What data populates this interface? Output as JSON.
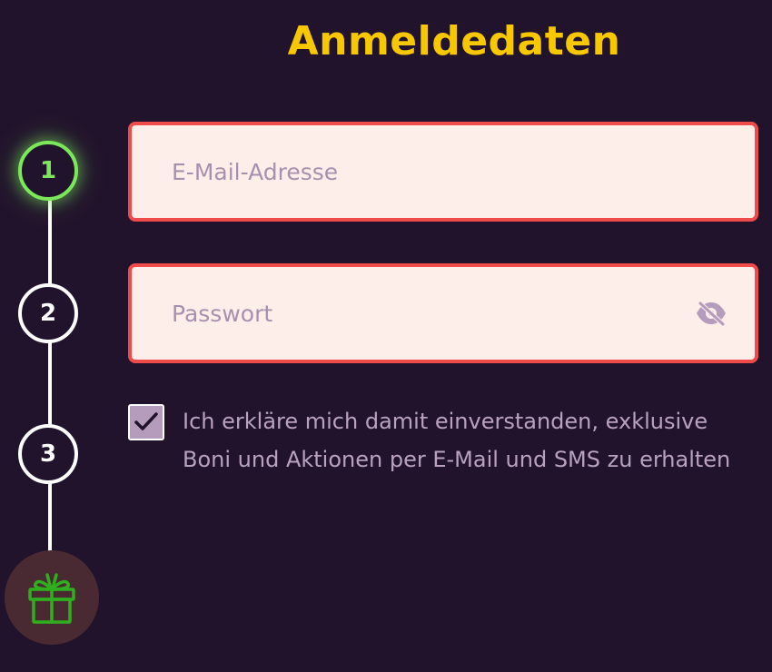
{
  "header": {
    "title": "Anmeldedaten"
  },
  "stepper": {
    "steps": [
      {
        "label": "1",
        "state": "active"
      },
      {
        "label": "2",
        "state": "inactive"
      },
      {
        "label": "3",
        "state": "inactive"
      }
    ],
    "reward_icon": "gift-icon"
  },
  "form": {
    "email": {
      "placeholder": "E-Mail-Adresse",
      "value": ""
    },
    "password": {
      "placeholder": "Passwort",
      "value": "",
      "toggle_icon": "eye-off-icon"
    },
    "consent": {
      "checked": true,
      "text": "Ich erkläre mich damit einverstanden, exklusive Boni und Aktionen per E-Mail und SMS zu erhalten"
    }
  },
  "colors": {
    "background": "#22132c",
    "title": "#f7c700",
    "active_step": "#7be85a",
    "field_border": "#f04b4b",
    "field_background": "#fdeeea",
    "gift": "#2fae1e"
  }
}
